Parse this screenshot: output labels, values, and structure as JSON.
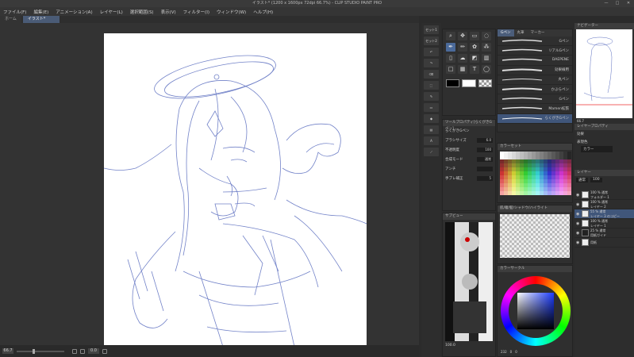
{
  "window": {
    "title": "イラスト* (1200 x 1600px 72dpi 66.7%) - CLIP STUDIO PAINT PRO",
    "controls": [
      "—",
      "□",
      "✕"
    ]
  },
  "menu": [
    "ファイル(F)",
    "編集(E)",
    "アニメーション(A)",
    "レイヤー(L)",
    "選択範囲(S)",
    "表示(V)",
    "フィルター(I)",
    "ウィンドウ(W)",
    "ヘルプ(H)"
  ],
  "tabs": [
    {
      "label": "ホーム"
    },
    {
      "label": "イラスト*"
    }
  ],
  "status": {
    "zoom": "66.7",
    "angle": "0.0"
  },
  "command_bar": [
    "セット1",
    "セット2"
  ],
  "subtool": {
    "tabs": [
      "Gペン",
      "丸筆",
      "マーカー"
    ],
    "brushes": [
      {
        "name": "Gペン"
      },
      {
        "name": "リアルGペン"
      },
      {
        "name": "DAEPENE"
      },
      {
        "name": "効果線用"
      },
      {
        "name": "丸ペン"
      },
      {
        "name": "かぶらペン"
      },
      {
        "name": "Gペン"
      },
      {
        "name": "Mamen拡張"
      },
      {
        "name": "らくがきGペン"
      }
    ]
  },
  "tool_property": {
    "title": "ツールプロパティ[らくがきGペン]",
    "tool_name": "らくがきGペン",
    "rows": [
      {
        "label": "ブラシサイズ",
        "value": "6.0"
      },
      {
        "label": "不透明度",
        "value": "100"
      },
      {
        "label": "合成モード",
        "value": "通常"
      },
      {
        "label": "アンチ",
        "value": ""
      },
      {
        "label": "手ブレ補正",
        "value": "5"
      }
    ]
  },
  "color_set": {
    "title": "カラーセット"
  },
  "history": {
    "title": "肌/瞳/髪/シャドウ/ハイライト"
  },
  "navigator_small": {
    "title": "サブビュー",
    "zoom": "100.0"
  },
  "color_wheel": {
    "title": "カラーサークル",
    "h": "232",
    "s": "0",
    "v": "0"
  },
  "right": {
    "navigator_title": "ナビゲーター",
    "nav_zoom": "66.7",
    "layer_prop_title": "レイヤープロパティ",
    "effect_label": "効果",
    "display_color_label": "表現色",
    "display_color_value": "カラー",
    "layers_title": "レイヤー",
    "blend": "通常",
    "opacity": "100",
    "layers": [
      {
        "mode": "100 % 通常",
        "name": "フォルダー 1"
      },
      {
        "mode": "100 % 通常",
        "name": "レイヤー 2"
      },
      {
        "mode": "55 % 通常",
        "name": "レイヤー 3 のコピー"
      },
      {
        "mode": "100 % 通常",
        "name": "レイヤー 1"
      },
      {
        "mode": "25 % 通常",
        "name": "用紙ガイド"
      },
      {
        "mode": "",
        "name": "用紙"
      }
    ]
  },
  "colors": {
    "accent": "#4b6a9a",
    "sketch": "#5a6dbf"
  }
}
